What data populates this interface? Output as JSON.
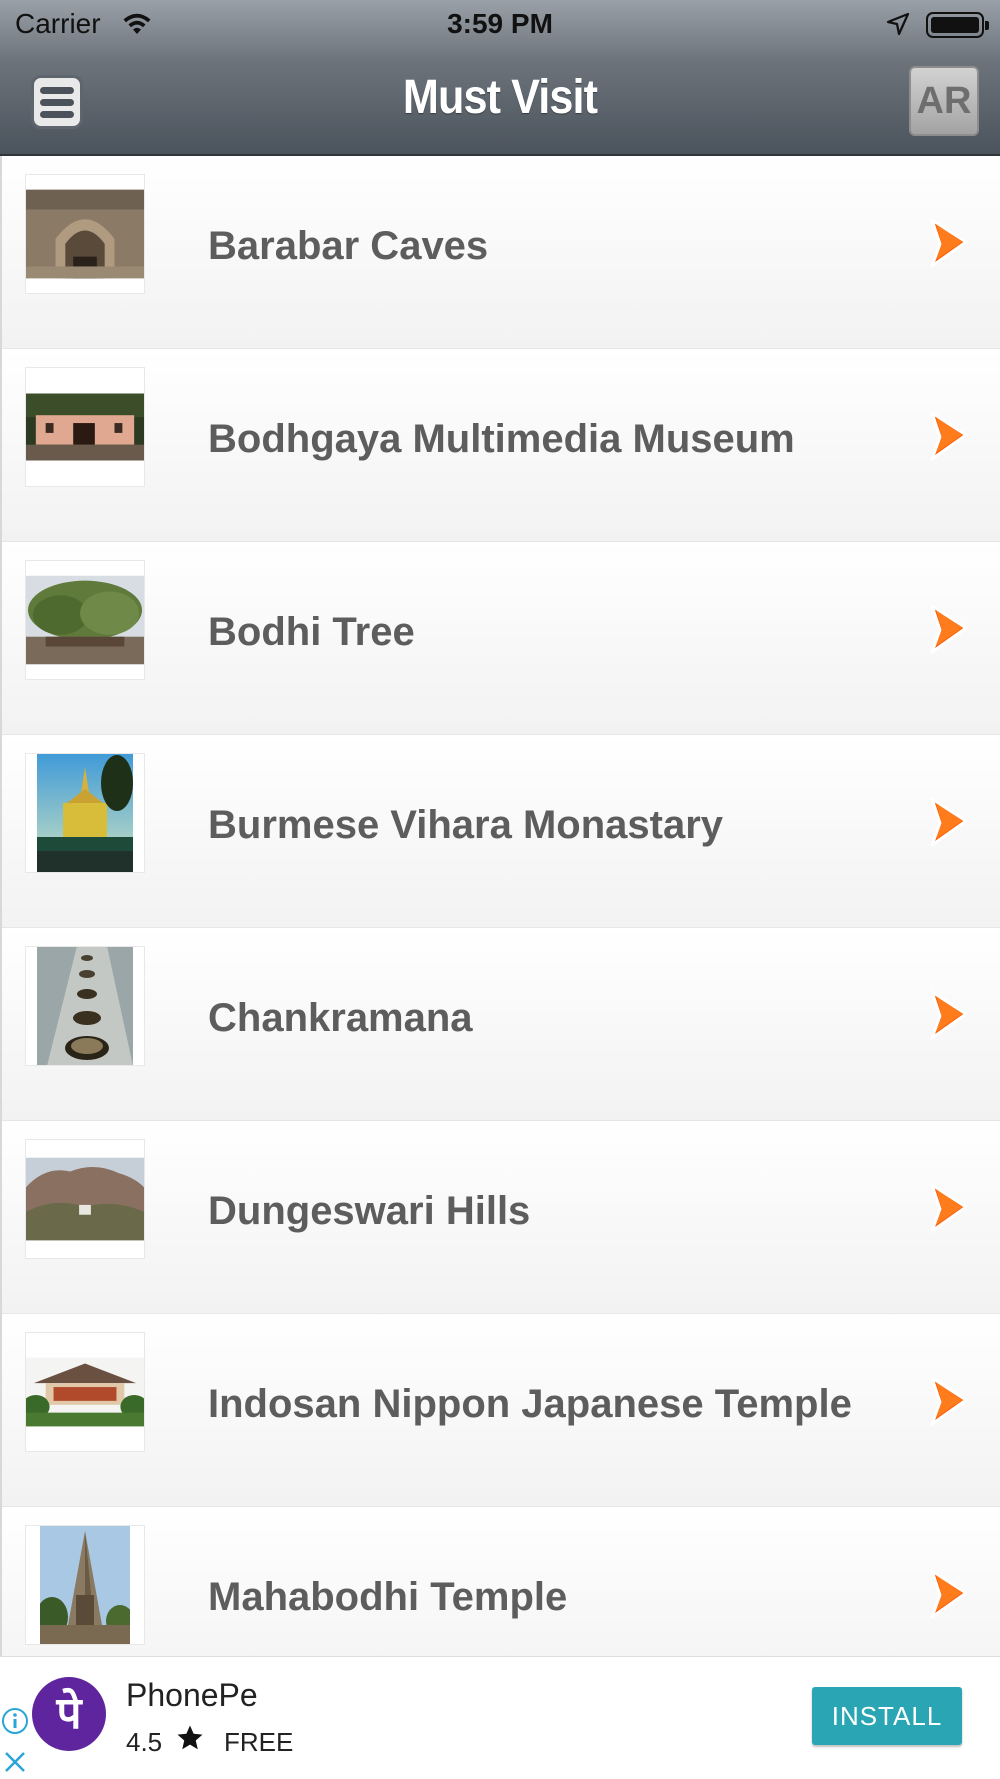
{
  "status_bar": {
    "carrier": "Carrier",
    "time": "3:59 PM"
  },
  "header": {
    "title": "Must Visit",
    "menu_icon": "hamburger-menu-icon",
    "ar_label": "AR"
  },
  "list": {
    "items": [
      {
        "label": "Barabar Caves"
      },
      {
        "label": "Bodhgaya Multimedia Museum"
      },
      {
        "label": "Bodhi Tree"
      },
      {
        "label": "Burmese Vihara Monastary"
      },
      {
        "label": "Chankramana"
      },
      {
        "label": "Dungeswari Hills"
      },
      {
        "label": "Indosan Nippon Japanese Temple"
      },
      {
        "label": "Mahabodhi Temple"
      }
    ],
    "chevron_color": "#ff5a00"
  },
  "ad": {
    "app_name": "PhonePe",
    "logo_text": "पे",
    "rating": "4.5",
    "price": "FREE",
    "install_label": "INSTALL",
    "install_color": "#2aa5b3"
  }
}
